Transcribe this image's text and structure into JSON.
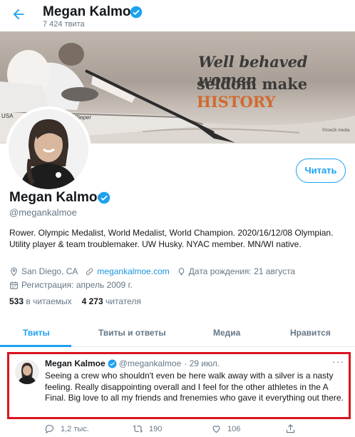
{
  "header": {
    "name": "Megan Kalmoe",
    "tweet_count": "7 424 твита"
  },
  "banner": {
    "line1_a": "Well behaved",
    "line1_b": "women",
    "line2_a": "seldom make",
    "line2_b": "HISTORY",
    "boat_text": "USA",
    "boat_name": "Chuck Pieper",
    "credit": "©row2k media"
  },
  "profile": {
    "follow_label": "Читать",
    "name": "Megan Kalmoe",
    "handle": "@megankalmoe",
    "bio": "Rower. Olympic Medalist, World Medalist, World Champion. 2020/16/12/08 Olympian. Utility player & team troublemaker. UW Husky. NYAC member. MN/WI native.",
    "location": "San Diego, CA",
    "website": "megankalmoe.com",
    "birthday": "Дата рождения: 21 августа",
    "joined": "Регистрация: апрель 2009 г.",
    "following_count": "533",
    "following_label": "в читаемых",
    "followers_count": "4 273",
    "followers_label": "читателя"
  },
  "tabs": [
    {
      "label": "Твиты"
    },
    {
      "label": "Твиты и ответы"
    },
    {
      "label": "Медиа"
    },
    {
      "label": "Нравится"
    }
  ],
  "tweet": {
    "author": "Megan Kalmoe",
    "handle": "@megankalmoe",
    "time": "· 29 июл.",
    "more": "···",
    "text": "Seeing a crew who shouldn't even be here walk away with a silver is a nasty feeling. Really disappointing overall and I feel for the other athletes in the A Final. Big love to all my friends and frenemies who gave it everything out there.",
    "replies": "1,2 тыс.",
    "retweets": "190",
    "likes": "106"
  },
  "colors": {
    "accent": "#1da1f2",
    "highlight_box": "#d9141e",
    "banner_orange": "#d16a2e"
  }
}
